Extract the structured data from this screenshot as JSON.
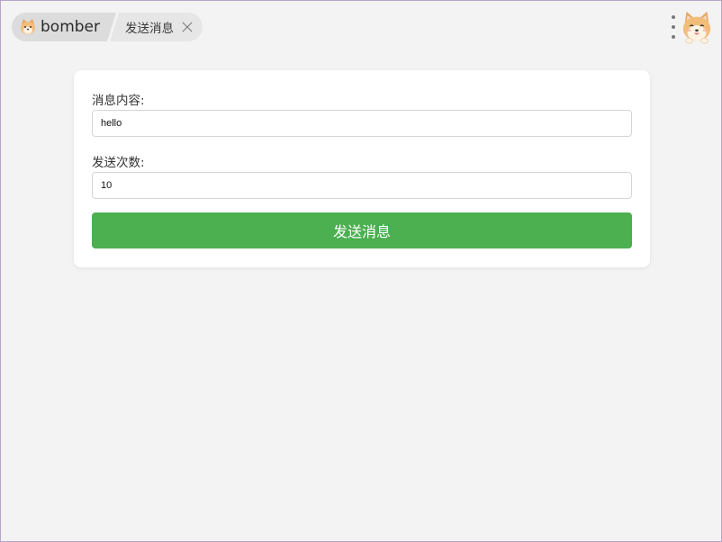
{
  "app": {
    "name": "bomber",
    "logo_icon": "shiba-dog-icon"
  },
  "tabs": [
    {
      "label": "发送消息",
      "close_icon": "close-icon"
    }
  ],
  "header": {
    "menu_icon": "more-vertical-icon",
    "avatar_icon": "shiba-dog-avatar"
  },
  "form": {
    "message_label": "消息内容:",
    "message_value": "hello",
    "count_label": "发送次数:",
    "count_value": "10",
    "submit_label": "发送消息"
  },
  "colors": {
    "background": "#f3f3f3",
    "card": "#ffffff",
    "button": "#4caf50",
    "tab": "#dcdcdc"
  }
}
